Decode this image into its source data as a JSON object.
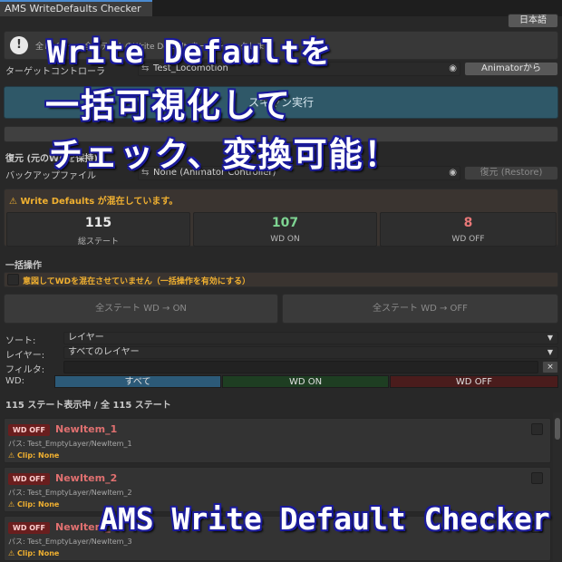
{
  "window": {
    "tab_title": "AMS WriteDefaults Checker",
    "language_button": "日本語"
  },
  "info": {
    "text": "全レイヤー・全ステートのWrite Defaultsを一括チェックします"
  },
  "target": {
    "label": "ターゲットコントローラ",
    "value": "Test_Locomotion",
    "from_animator_button": "Animatorから"
  },
  "scan_button": "スキャン実行",
  "fix_button": "",
  "restore": {
    "section_title": "復元 (元のWDを保持)",
    "backup_label": "バックアップファイル",
    "backup_value": "None (Animator Controller)",
    "restore_button": "復元 (Restore)"
  },
  "warning": {
    "text": "Write Defaults が混在しています。"
  },
  "stats": [
    {
      "value": "115",
      "label": "総ステート",
      "color": "#e8e8e8"
    },
    {
      "value": "107",
      "label": "WD ON",
      "color": "#7ed492"
    },
    {
      "value": "8",
      "label": "WD OFF",
      "color": "#e87878"
    }
  ],
  "bulk": {
    "section_title": "一括操作",
    "toggle_label": "意図してWDを混在させていません（一括操作を有効にする）",
    "all_on_button": "全ステート WD → ON",
    "all_off_button": "全ステート WD → OFF"
  },
  "filters": {
    "sort_label": "ソート:",
    "sort_value": "レイヤー",
    "layer_label": "レイヤー:",
    "layer_value": "すべてのレイヤー",
    "filter_label": "フィルタ:",
    "clear_button": "×",
    "wd_label": "WD:",
    "segments": [
      {
        "label": "すべて",
        "color": "#2c5a78"
      },
      {
        "label": "WD ON",
        "color": "#1e3e22"
      },
      {
        "label": "WD OFF",
        "color": "#4a1c1c"
      }
    ]
  },
  "count_text": "115 ステート表示中 / 全 115 ステート",
  "items": [
    {
      "badge": "WD OFF",
      "name": "NewItem_1",
      "path": "パス: Test_EmptyLayer/NewItem_1",
      "clip": "Clip: None"
    },
    {
      "badge": "WD OFF",
      "name": "NewItem_2",
      "path": "パス: Test_EmptyLayer/NewItem_2",
      "clip": "Clip: None"
    },
    {
      "badge": "WD OFF",
      "name": "NewItem_3",
      "path": "パス: Test_EmptyLayer/NewItem_3",
      "clip": "Clip: None"
    }
  ],
  "overlay": {
    "line1": "Write Defaultを",
    "line2": "一括可視化して",
    "line3": "チェック、変換可能！",
    "line4": "AMS Write Default Checker"
  },
  "colors": {
    "accent_blue": "#2f5868",
    "warning": "#f0b030",
    "wd_on": "#7ed492",
    "wd_off": "#e87878",
    "overlay_outline": "#1a1a9a"
  }
}
